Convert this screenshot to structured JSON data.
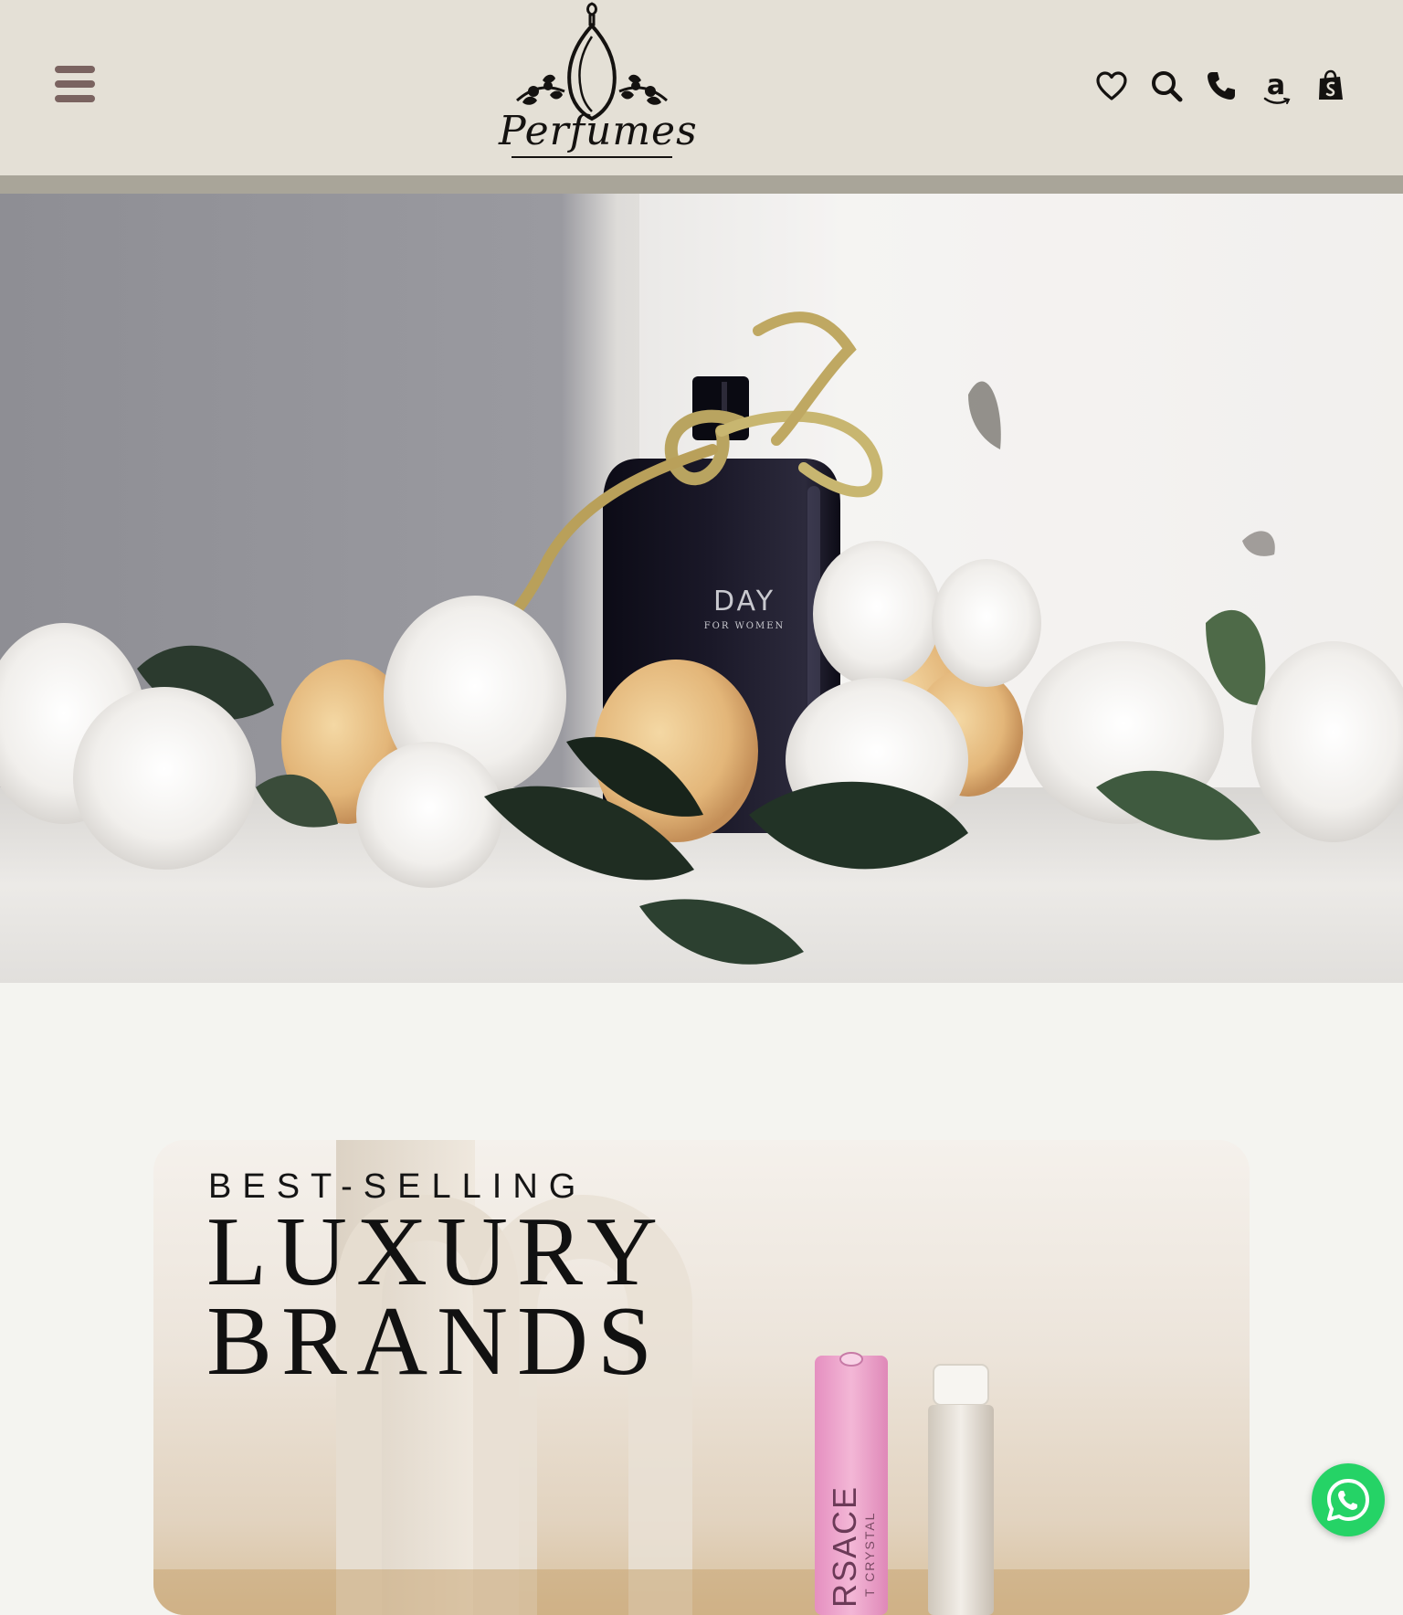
{
  "header": {
    "logo_text": "Perfumes",
    "icons": [
      "menu-icon",
      "heart-icon",
      "search-icon",
      "phone-icon",
      "amazon-icon",
      "shopify-bag-icon"
    ],
    "amazon_glyph": "a"
  },
  "hero": {
    "bottle_name": "DAY",
    "bottle_sub": "FOR WOMEN"
  },
  "promo": {
    "kicker": "BEST-SELLING",
    "title_line1": "LUXURY",
    "title_line2": "BRANDS",
    "vial_left_text": "RSACE",
    "vial_left_sub": "T CRYSTAL"
  },
  "colors": {
    "header_bg": "#e4e0d6",
    "header_stripe": "#a9a599",
    "menu_icon": "#7a6360",
    "page_bg": "#f4f4f0",
    "whatsapp": "#25d366"
  }
}
